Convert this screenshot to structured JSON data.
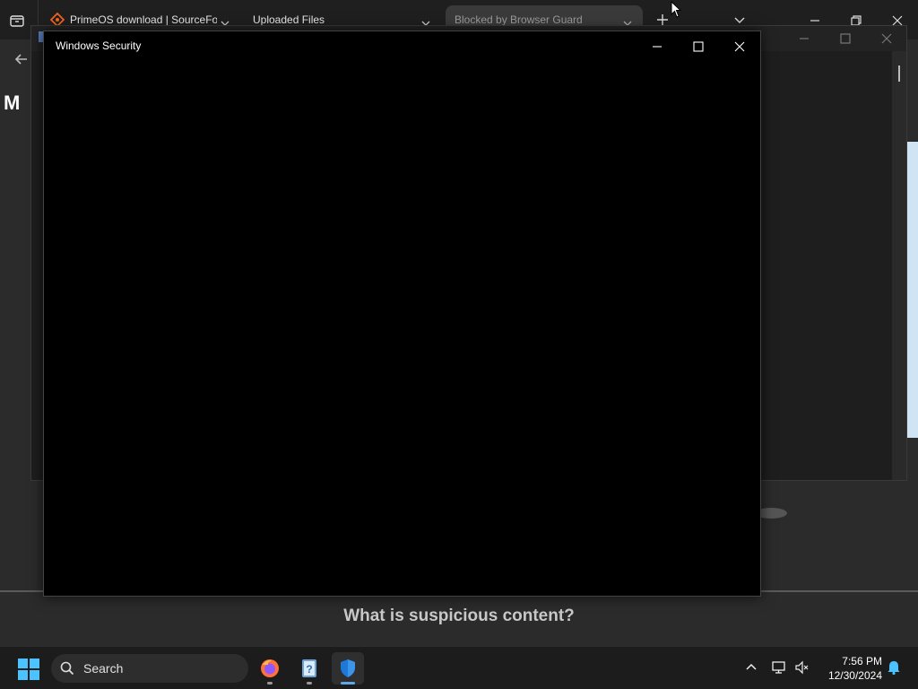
{
  "browser": {
    "tabs": [
      {
        "title": "PrimeOS download | SourceForge.net",
        "active": false
      },
      {
        "title": "Uploaded Files",
        "active": false
      },
      {
        "title": "Blocked by Browser Guard",
        "active": true
      }
    ],
    "page": {
      "logo_text": "M",
      "heading": "What is suspicious content?"
    }
  },
  "dialog": {
    "title": "Windows Security",
    "background_color": "#000000"
  },
  "taskbar": {
    "search_label": "Search",
    "apps": [
      {
        "name": "Firefox",
        "icon": "firefox-icon"
      },
      {
        "name": "Help",
        "icon": "help-book-icon"
      },
      {
        "name": "Windows Security",
        "icon": "shield-icon"
      }
    ],
    "clock": {
      "time": "7:56 PM",
      "date": "12/30/2024"
    }
  },
  "colors": {
    "accent": "#5ea7e8",
    "taskbar": "#1c1c1c",
    "tab_active": "#3a3a3a"
  }
}
